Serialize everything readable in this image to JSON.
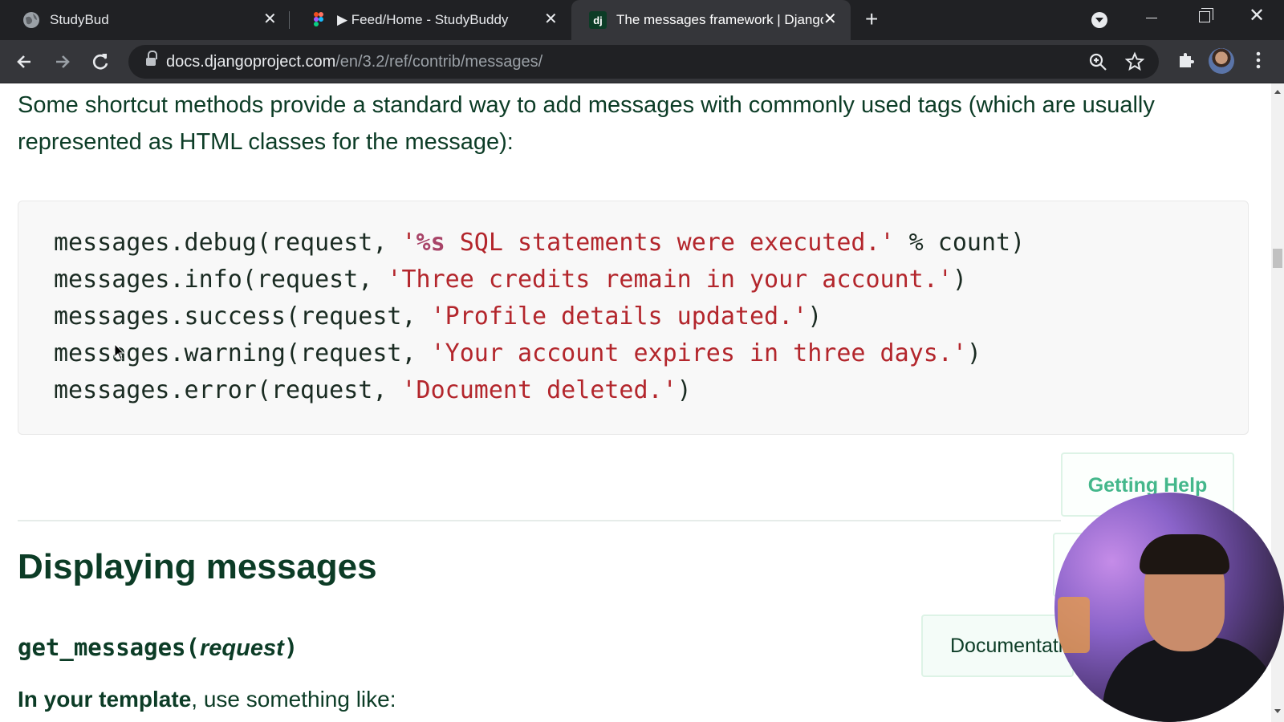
{
  "browser": {
    "tabs": [
      {
        "title": "StudyBud",
        "icon": "globe-icon",
        "active": false
      },
      {
        "title": "▶ Feed/Home - StudyBuddy",
        "icon": "figma-icon",
        "active": false
      },
      {
        "title": "The messages framework | Django",
        "icon": "django-icon",
        "icon_text": "dj",
        "active": true
      }
    ],
    "new_tab_glyph": "+",
    "close_glyph": "✕",
    "url_host": "docs.djangoproject.com",
    "url_path": "/en/3.2/ref/contrib/messages/"
  },
  "content": {
    "intro": "Some shortcut methods provide a standard way to add messages with commonly used tags (which are usually represented as HTML classes for the message):",
    "code_lines": [
      {
        "pre": "messages.debug(request, ",
        "str_open": "'",
        "fmt": "%s",
        "str_rest": " SQL statements were executed.'",
        "post": " % count)"
      },
      {
        "pre": "messages.info(request, ",
        "str": "'Three credits remain in your account.'",
        "post": ")"
      },
      {
        "pre": "messages.success(request, ",
        "str": "'Profile details updated.'",
        "post": ")"
      },
      {
        "pre": "messages.warning(request, ",
        "str": "'Your account expires in three days.'",
        "post": ")"
      },
      {
        "pre": "messages.error(request, ",
        "str": "'Document deleted.'",
        "post": ")"
      }
    ],
    "heading": "Displaying messages",
    "signature_code": "get_messages(",
    "signature_param": "request",
    "signature_close": ")",
    "template_bold": "In your template",
    "template_rest": ", use something like:"
  },
  "sidebar": {
    "getting_help": "Getting Help",
    "documentation": "Documentation"
  },
  "colors": {
    "django_green": "#0c3c26",
    "accent_green": "#44b78b",
    "string_red": "#b3262c",
    "chrome_dark": "#202124"
  }
}
